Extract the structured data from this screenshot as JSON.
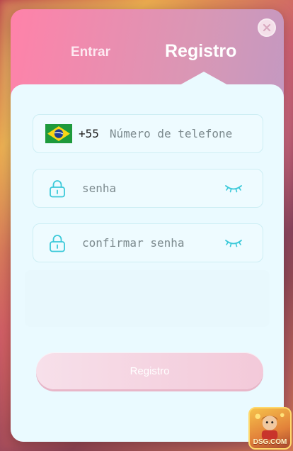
{
  "tabs": {
    "login_label": "Entrar",
    "register_label": "Registro",
    "active": "register"
  },
  "form": {
    "phone": {
      "country_flag": "brazil-flag-icon",
      "country_code": "+55",
      "placeholder": "Número de telefone",
      "value": ""
    },
    "password": {
      "placeholder": "senha",
      "value": ""
    },
    "confirm_password": {
      "placeholder": "confirmar senha",
      "value": ""
    }
  },
  "submit_label": "Registro",
  "logo_text": "DSG.COM",
  "colors": {
    "header_start": "#ff82a9",
    "header_end": "#b79ac8",
    "panel": "#eafaff",
    "accent_icon": "#3bc9d9",
    "submit_button": "#f3c9d9"
  }
}
